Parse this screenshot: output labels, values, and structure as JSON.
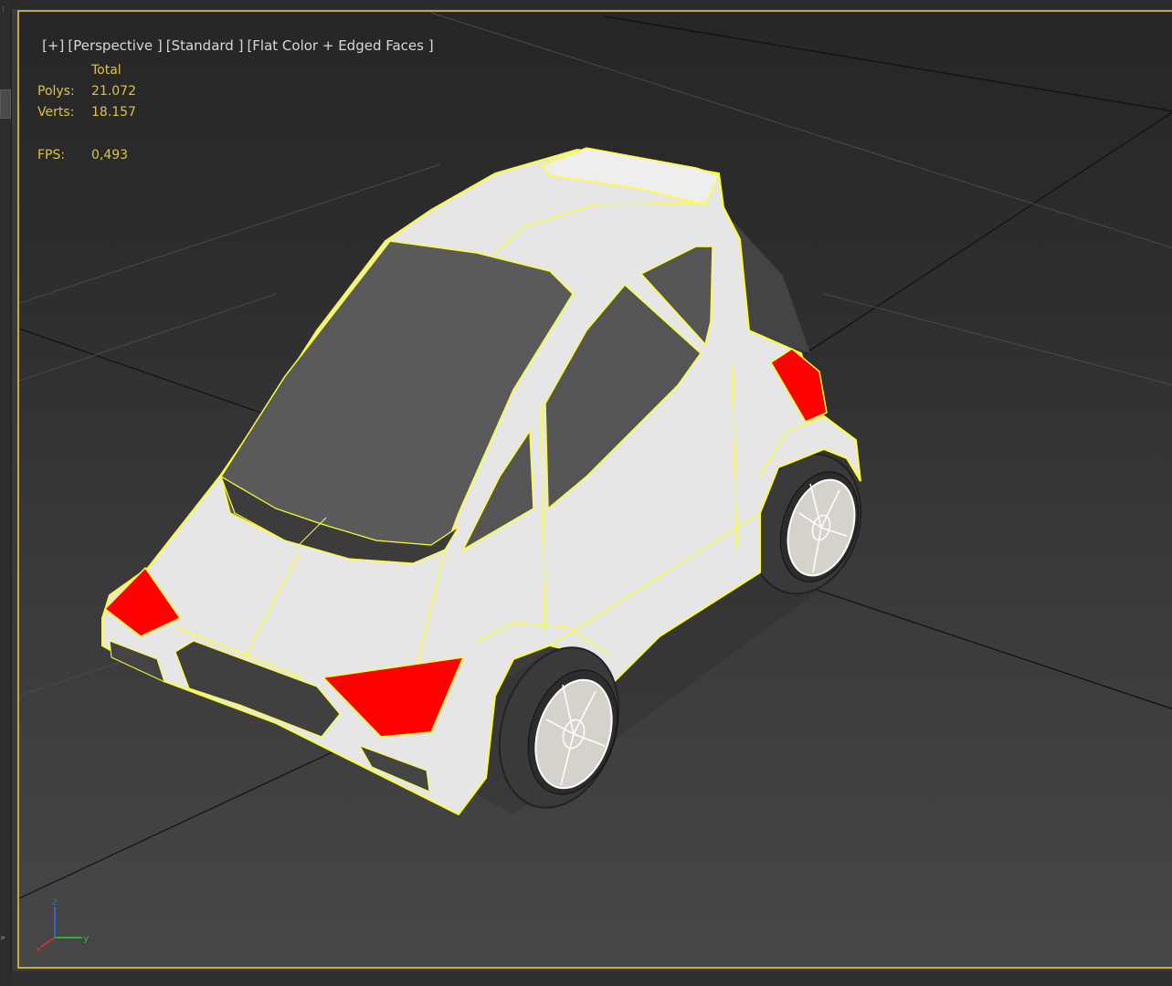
{
  "viewport": {
    "label_parts": [
      "[+]",
      "[Perspective ]",
      "[Standard ]",
      "[Flat Color + Edged Faces ]"
    ],
    "stats": {
      "header": "Total",
      "rows": [
        {
          "label": "Polys:",
          "value": "21.072"
        },
        {
          "label": "Verts:",
          "value": "18.157"
        },
        {
          "label": "FPS:",
          "value": "0,493"
        }
      ]
    },
    "axis": {
      "z": "z",
      "x": "x",
      "y": "y"
    },
    "colors": {
      "border_active": "#c8a838",
      "stats_text": "#dcc24a",
      "selection_edges": "#ffff33",
      "body": "#e6e6e6",
      "glass": "#555555",
      "light": "#ff0000"
    }
  }
}
